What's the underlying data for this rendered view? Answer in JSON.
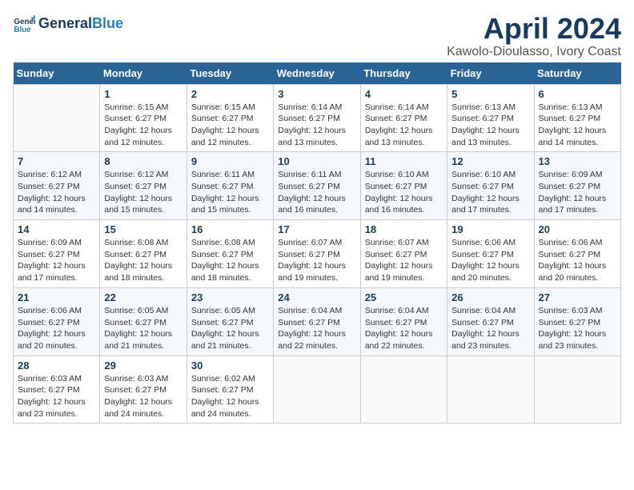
{
  "logo": {
    "text_general": "General",
    "text_blue": "Blue"
  },
  "title": "April 2024",
  "location": "Kawolo-Dioulasso, Ivory Coast",
  "days_of_week": [
    "Sunday",
    "Monday",
    "Tuesday",
    "Wednesday",
    "Thursday",
    "Friday",
    "Saturday"
  ],
  "weeks": [
    [
      {
        "num": "",
        "info": ""
      },
      {
        "num": "1",
        "info": "Sunrise: 6:15 AM\nSunset: 6:27 PM\nDaylight: 12 hours\nand 12 minutes."
      },
      {
        "num": "2",
        "info": "Sunrise: 6:15 AM\nSunset: 6:27 PM\nDaylight: 12 hours\nand 12 minutes."
      },
      {
        "num": "3",
        "info": "Sunrise: 6:14 AM\nSunset: 6:27 PM\nDaylight: 12 hours\nand 13 minutes."
      },
      {
        "num": "4",
        "info": "Sunrise: 6:14 AM\nSunset: 6:27 PM\nDaylight: 12 hours\nand 13 minutes."
      },
      {
        "num": "5",
        "info": "Sunrise: 6:13 AM\nSunset: 6:27 PM\nDaylight: 12 hours\nand 13 minutes."
      },
      {
        "num": "6",
        "info": "Sunrise: 6:13 AM\nSunset: 6:27 PM\nDaylight: 12 hours\nand 14 minutes."
      }
    ],
    [
      {
        "num": "7",
        "info": "Sunrise: 6:12 AM\nSunset: 6:27 PM\nDaylight: 12 hours\nand 14 minutes."
      },
      {
        "num": "8",
        "info": "Sunrise: 6:12 AM\nSunset: 6:27 PM\nDaylight: 12 hours\nand 15 minutes."
      },
      {
        "num": "9",
        "info": "Sunrise: 6:11 AM\nSunset: 6:27 PM\nDaylight: 12 hours\nand 15 minutes."
      },
      {
        "num": "10",
        "info": "Sunrise: 6:11 AM\nSunset: 6:27 PM\nDaylight: 12 hours\nand 16 minutes."
      },
      {
        "num": "11",
        "info": "Sunrise: 6:10 AM\nSunset: 6:27 PM\nDaylight: 12 hours\nand 16 minutes."
      },
      {
        "num": "12",
        "info": "Sunrise: 6:10 AM\nSunset: 6:27 PM\nDaylight: 12 hours\nand 17 minutes."
      },
      {
        "num": "13",
        "info": "Sunrise: 6:09 AM\nSunset: 6:27 PM\nDaylight: 12 hours\nand 17 minutes."
      }
    ],
    [
      {
        "num": "14",
        "info": "Sunrise: 6:09 AM\nSunset: 6:27 PM\nDaylight: 12 hours\nand 17 minutes."
      },
      {
        "num": "15",
        "info": "Sunrise: 6:08 AM\nSunset: 6:27 PM\nDaylight: 12 hours\nand 18 minutes."
      },
      {
        "num": "16",
        "info": "Sunrise: 6:08 AM\nSunset: 6:27 PM\nDaylight: 12 hours\nand 18 minutes."
      },
      {
        "num": "17",
        "info": "Sunrise: 6:07 AM\nSunset: 6:27 PM\nDaylight: 12 hours\nand 19 minutes."
      },
      {
        "num": "18",
        "info": "Sunrise: 6:07 AM\nSunset: 6:27 PM\nDaylight: 12 hours\nand 19 minutes."
      },
      {
        "num": "19",
        "info": "Sunrise: 6:06 AM\nSunset: 6:27 PM\nDaylight: 12 hours\nand 20 minutes."
      },
      {
        "num": "20",
        "info": "Sunrise: 6:06 AM\nSunset: 6:27 PM\nDaylight: 12 hours\nand 20 minutes."
      }
    ],
    [
      {
        "num": "21",
        "info": "Sunrise: 6:06 AM\nSunset: 6:27 PM\nDaylight: 12 hours\nand 20 minutes."
      },
      {
        "num": "22",
        "info": "Sunrise: 6:05 AM\nSunset: 6:27 PM\nDaylight: 12 hours\nand 21 minutes."
      },
      {
        "num": "23",
        "info": "Sunrise: 6:05 AM\nSunset: 6:27 PM\nDaylight: 12 hours\nand 21 minutes."
      },
      {
        "num": "24",
        "info": "Sunrise: 6:04 AM\nSunset: 6:27 PM\nDaylight: 12 hours\nand 22 minutes."
      },
      {
        "num": "25",
        "info": "Sunrise: 6:04 AM\nSunset: 6:27 PM\nDaylight: 12 hours\nand 22 minutes."
      },
      {
        "num": "26",
        "info": "Sunrise: 6:04 AM\nSunset: 6:27 PM\nDaylight: 12 hours\nand 23 minutes."
      },
      {
        "num": "27",
        "info": "Sunrise: 6:03 AM\nSunset: 6:27 PM\nDaylight: 12 hours\nand 23 minutes."
      }
    ],
    [
      {
        "num": "28",
        "info": "Sunrise: 6:03 AM\nSunset: 6:27 PM\nDaylight: 12 hours\nand 23 minutes."
      },
      {
        "num": "29",
        "info": "Sunrise: 6:03 AM\nSunset: 6:27 PM\nDaylight: 12 hours\nand 24 minutes."
      },
      {
        "num": "30",
        "info": "Sunrise: 6:02 AM\nSunset: 6:27 PM\nDaylight: 12 hours\nand 24 minutes."
      },
      {
        "num": "",
        "info": ""
      },
      {
        "num": "",
        "info": ""
      },
      {
        "num": "",
        "info": ""
      },
      {
        "num": "",
        "info": ""
      }
    ]
  ]
}
